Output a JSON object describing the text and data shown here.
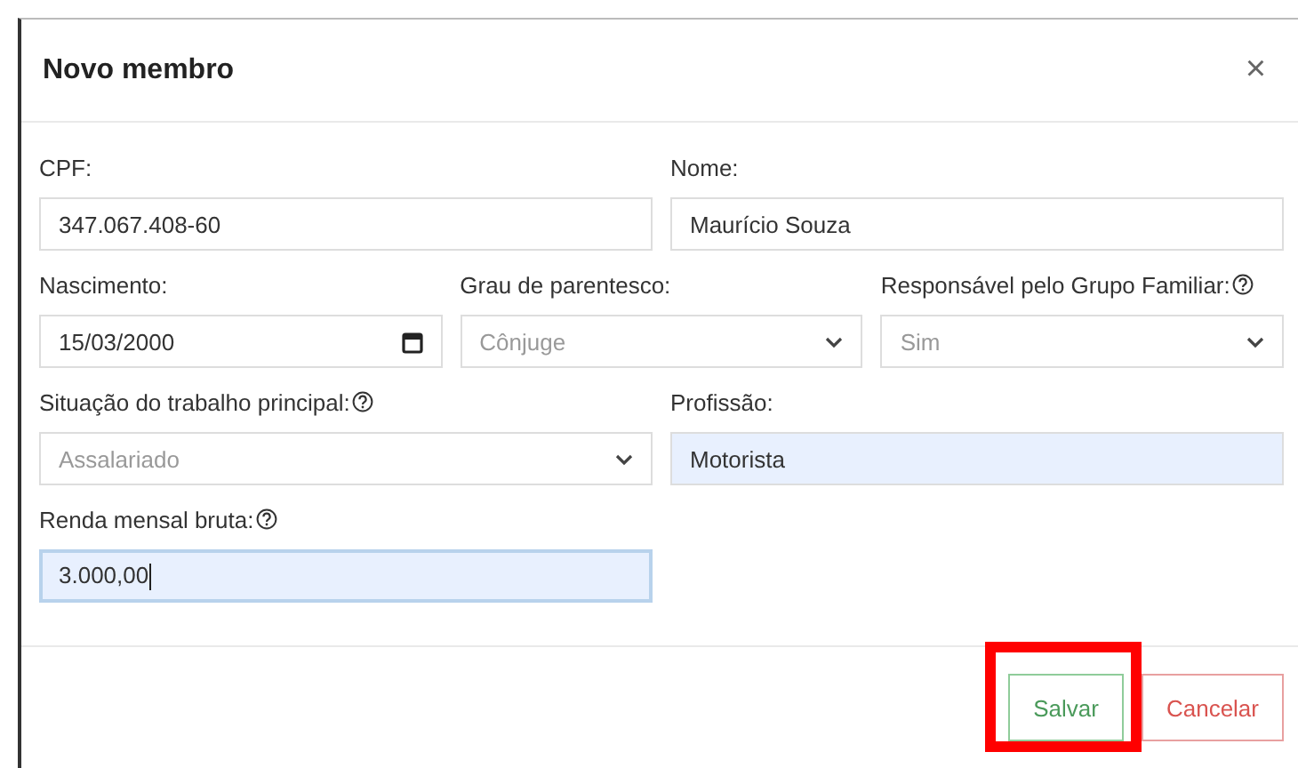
{
  "dialog": {
    "title": "Novo membro",
    "close": "×"
  },
  "rows": [
    [
      {
        "kind": "text",
        "label": "CPF:",
        "help": false,
        "value": "347.067.408-60",
        "autofilled": false,
        "focused": false
      },
      {
        "kind": "text",
        "label": "Nome:",
        "help": false,
        "value": "Maurício Souza",
        "autofilled": false,
        "focused": false
      }
    ],
    [
      {
        "kind": "date",
        "label": "Nascimento:",
        "help": false,
        "value": "15/03/2000",
        "autofilled": false,
        "focused": false
      },
      {
        "kind": "select",
        "label": "Grau de parentesco:",
        "help": false,
        "value": "Cônjuge",
        "autofilled": false,
        "focused": false
      },
      {
        "kind": "select",
        "label": "Responsável pelo Grupo Familiar:",
        "help": true,
        "value": "Sim",
        "autofilled": false,
        "focused": false
      }
    ],
    [
      {
        "kind": "select",
        "label": "Situação do trabalho principal:",
        "help": true,
        "value": "Assalariado",
        "autofilled": false,
        "focused": false
      },
      {
        "kind": "text",
        "label": "Profissão:",
        "help": false,
        "value": "Motorista",
        "autofilled": true,
        "focused": false
      }
    ],
    [
      {
        "kind": "text",
        "label": "Renda mensal bruta:",
        "help": true,
        "value": "3.000,00",
        "autofilled": true,
        "focused": true
      }
    ]
  ],
  "buttons": [
    {
      "kind": "save",
      "label": "Salvar",
      "highlighted": true
    },
    {
      "kind": "cancel",
      "label": "Cancelar",
      "highlighted": false
    }
  ]
}
